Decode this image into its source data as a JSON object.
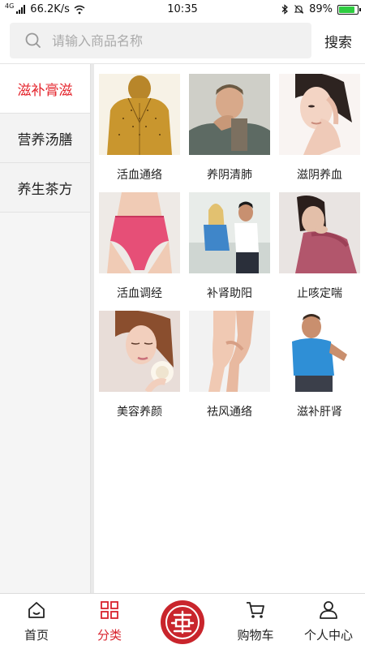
{
  "status": {
    "network_type": "4G",
    "speed": "66.2K/s",
    "time": "10:35",
    "battery_percent": "89%",
    "battery_level": 0.89,
    "accent_green": "#2ecc40"
  },
  "search": {
    "placeholder": "请输入商品名称",
    "button_label": "搜索"
  },
  "sidebar": {
    "items": [
      {
        "label": "滋补膏滋",
        "active": true
      },
      {
        "label": "营养汤膳",
        "active": false
      },
      {
        "label": "养生茶方",
        "active": false
      }
    ],
    "active_color": "#e4232b"
  },
  "products": [
    {
      "label": "活血通络",
      "image": "acupuncture-body-figure"
    },
    {
      "label": "养阴清肺",
      "image": "man-coughing"
    },
    {
      "label": "滋阴养血",
      "image": "woman-touching-face"
    },
    {
      "label": "活血调经",
      "image": "pink-underwear"
    },
    {
      "label": "补肾助阳",
      "image": "couple-on-sofa"
    },
    {
      "label": "止咳定喘",
      "image": "woman-coughing"
    },
    {
      "label": "美容养颜",
      "image": "woman-with-rose"
    },
    {
      "label": "祛风通络",
      "image": "knees-legs"
    },
    {
      "label": "滋补肝肾",
      "image": "man-back-pain"
    }
  ],
  "tabbar": {
    "items": [
      {
        "label": "首页",
        "icon": "home-icon",
        "active": false
      },
      {
        "label": "分类",
        "icon": "grid-icon",
        "active": true
      },
      {
        "label": "",
        "icon": "brand-logo-icon",
        "active": false
      },
      {
        "label": "购物车",
        "icon": "cart-icon",
        "active": false
      },
      {
        "label": "个人中心",
        "icon": "user-icon",
        "active": false
      }
    ],
    "active_color": "#d9232d"
  }
}
